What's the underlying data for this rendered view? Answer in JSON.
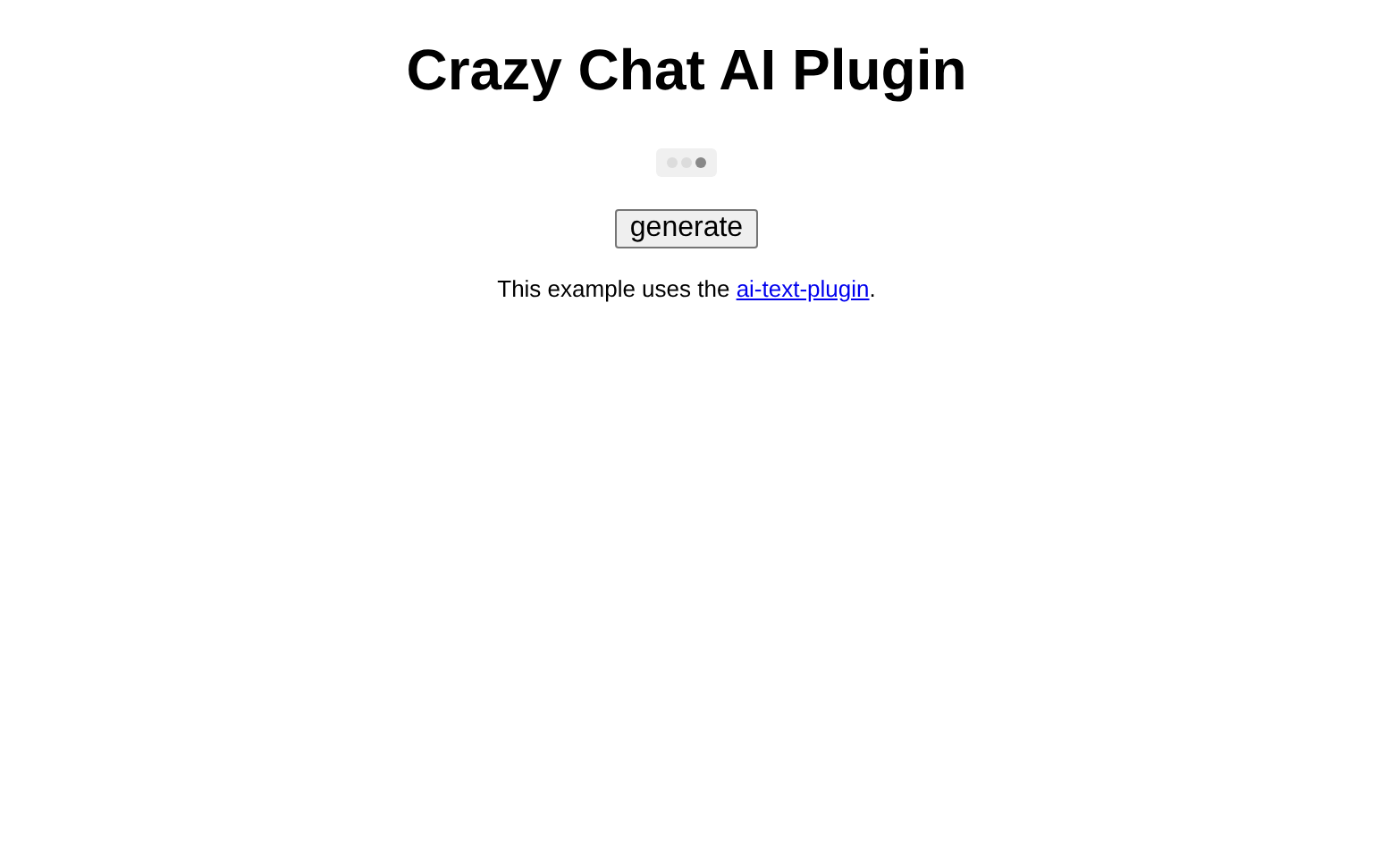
{
  "title": "Crazy Chat AI Plugin",
  "typing_indicator": {
    "dots": [
      {
        "selected": false
      },
      {
        "selected": false
      },
      {
        "selected": true
      }
    ]
  },
  "button": "generate",
  "note": {
    "before": "This example uses the ",
    "link": "ai-text-plugin",
    "after": "."
  }
}
